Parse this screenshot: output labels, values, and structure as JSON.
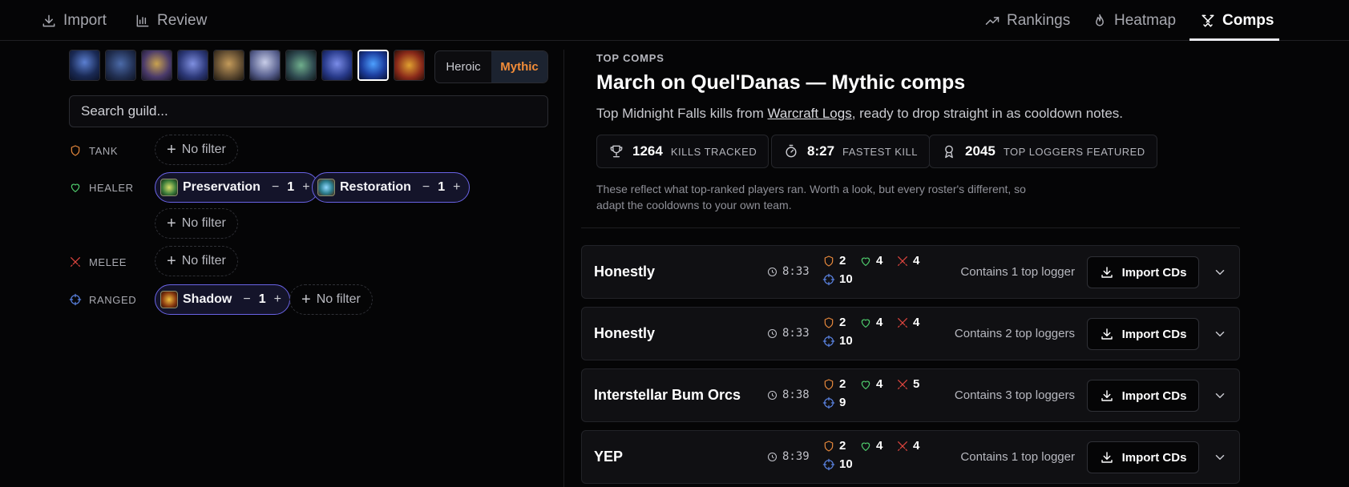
{
  "nav": {
    "left": [
      {
        "label": "Import",
        "icon": "download-icon"
      },
      {
        "label": "Review",
        "icon": "bar-chart-icon"
      }
    ],
    "right": [
      {
        "label": "Rankings",
        "icon": "trending-up-icon"
      },
      {
        "label": "Heatmap",
        "icon": "flame-icon"
      },
      {
        "label": "Comps",
        "icon": "crossed-swords-icon",
        "active": true
      }
    ]
  },
  "bosses": {
    "count": 10,
    "selected_index": 8
  },
  "difficulty": {
    "options": [
      "Heroic",
      "Mythic"
    ],
    "selected": "Mythic",
    "accent": "#f28c38"
  },
  "search": {
    "placeholder": "Search guild..."
  },
  "filters": {
    "no_filter_label": "No filter",
    "tank": {
      "label": "TANK",
      "color": "#e8893c"
    },
    "healer": {
      "label": "HEALER",
      "color": "#4ec96b",
      "specs": [
        {
          "name": "Preservation",
          "count": "1"
        },
        {
          "name": "Restoration",
          "count": "1"
        }
      ]
    },
    "melee": {
      "label": "MELEE",
      "color": "#e0463f"
    },
    "ranged": {
      "label": "RANGED",
      "color": "#5a82e0",
      "specs": [
        {
          "name": "Shadow",
          "count": "1"
        }
      ]
    }
  },
  "header": {
    "kicker": "TOP COMPS",
    "title": "March on Quel'Danas — Mythic comps",
    "subtitle_pre": "Top Midnight Falls kills from ",
    "subtitle_link": "Warcraft Logs",
    "subtitle_post": ", ready to drop straight in as cooldown notes."
  },
  "stats": [
    {
      "value": "1264",
      "label": "KILLS TRACKED",
      "icon": "trophy-icon"
    },
    {
      "value": "8:27",
      "label": "FASTEST KILL",
      "icon": "stopwatch-icon"
    },
    {
      "value": "2045",
      "label": "TOP LOGGERS FEATURED",
      "icon": "award-icon"
    }
  ],
  "note": "These reflect what top-ranked players ran. Worth a look, but every roster's different, so adapt the cooldowns to your own team.",
  "import_label": "Import CDs",
  "comps": [
    {
      "name": "Honestly",
      "time": "8:33",
      "tank": "2",
      "healer": "4",
      "melee": "4",
      "ranged": "10",
      "contains": "Contains 1 top logger"
    },
    {
      "name": "Honestly",
      "time": "8:33",
      "tank": "2",
      "healer": "4",
      "melee": "4",
      "ranged": "10",
      "contains": "Contains 2 top loggers"
    },
    {
      "name": "Interstellar Bum Orcs",
      "time": "8:38",
      "tank": "2",
      "healer": "4",
      "melee": "5",
      "ranged": "9",
      "contains": "Contains 3 top loggers"
    },
    {
      "name": "YEP",
      "time": "8:39",
      "tank": "2",
      "healer": "4",
      "melee": "4",
      "ranged": "10",
      "contains": "Contains 1 top logger"
    }
  ]
}
